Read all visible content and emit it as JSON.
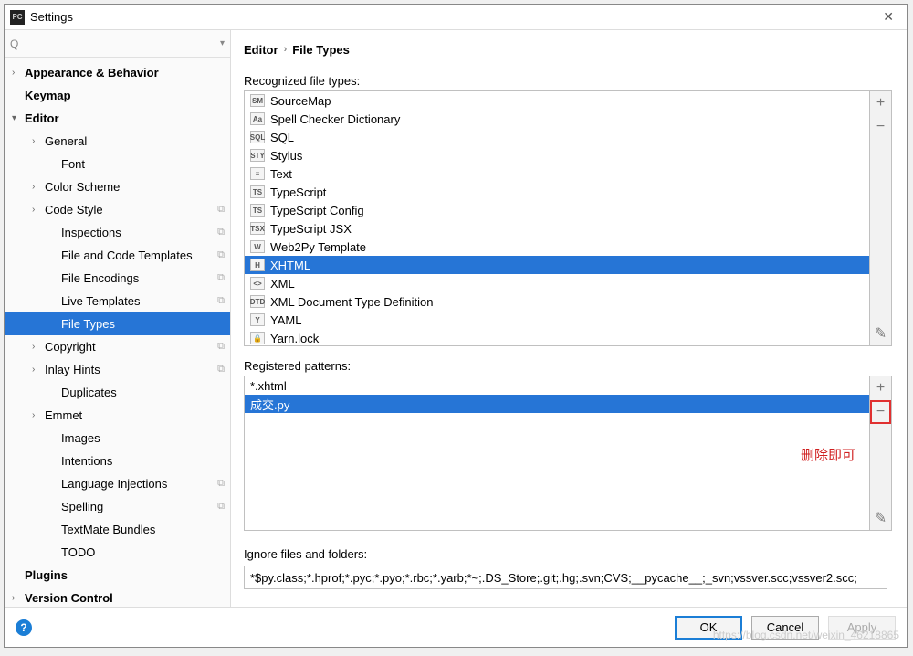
{
  "window": {
    "title": "Settings"
  },
  "search": {
    "placeholder": ""
  },
  "tree": [
    {
      "label": "Appearance & Behavior",
      "lvl": 0,
      "exp": ">",
      "bold": true
    },
    {
      "label": "Keymap",
      "lvl": 0,
      "exp": "",
      "bold": true
    },
    {
      "label": "Editor",
      "lvl": 0,
      "exp": "v",
      "bold": true
    },
    {
      "label": "General",
      "lvl": 1,
      "exp": ">"
    },
    {
      "label": "Font",
      "lvl": 2,
      "exp": ""
    },
    {
      "label": "Color Scheme",
      "lvl": 1,
      "exp": ">"
    },
    {
      "label": "Code Style",
      "lvl": 1,
      "exp": ">",
      "copy": true
    },
    {
      "label": "Inspections",
      "lvl": 2,
      "exp": "",
      "copy": true
    },
    {
      "label": "File and Code Templates",
      "lvl": 2,
      "exp": "",
      "copy": true
    },
    {
      "label": "File Encodings",
      "lvl": 2,
      "exp": "",
      "copy": true
    },
    {
      "label": "Live Templates",
      "lvl": 2,
      "exp": "",
      "copy": true
    },
    {
      "label": "File Types",
      "lvl": 2,
      "exp": "",
      "selected": true
    },
    {
      "label": "Copyright",
      "lvl": 1,
      "exp": ">",
      "copy": true
    },
    {
      "label": "Inlay Hints",
      "lvl": 1,
      "exp": ">",
      "copy": true
    },
    {
      "label": "Duplicates",
      "lvl": 2,
      "exp": ""
    },
    {
      "label": "Emmet",
      "lvl": 1,
      "exp": ">"
    },
    {
      "label": "Images",
      "lvl": 2,
      "exp": ""
    },
    {
      "label": "Intentions",
      "lvl": 2,
      "exp": ""
    },
    {
      "label": "Language Injections",
      "lvl": 2,
      "exp": "",
      "copy": true
    },
    {
      "label": "Spelling",
      "lvl": 2,
      "exp": "",
      "copy": true
    },
    {
      "label": "TextMate Bundles",
      "lvl": 2,
      "exp": ""
    },
    {
      "label": "TODO",
      "lvl": 2,
      "exp": ""
    },
    {
      "label": "Plugins",
      "lvl": 0,
      "exp": "",
      "bold": true
    },
    {
      "label": "Version Control",
      "lvl": 0,
      "exp": ">",
      "bold": true
    }
  ],
  "breadcrumb": {
    "a": "Editor",
    "b": "File Types"
  },
  "labels": {
    "recognized": "Recognized file types:",
    "registered": "Registered patterns:",
    "ignore": "Ignore files and folders:"
  },
  "file_types": [
    {
      "label": "SourceMap",
      "icon": "SM"
    },
    {
      "label": "Spell Checker Dictionary",
      "icon": "Aa"
    },
    {
      "label": "SQL",
      "icon": "SQL"
    },
    {
      "label": "Stylus",
      "icon": "STY"
    },
    {
      "label": "Text",
      "icon": "≡"
    },
    {
      "label": "TypeScript",
      "icon": "TS"
    },
    {
      "label": "TypeScript Config",
      "icon": "TS"
    },
    {
      "label": "TypeScript JSX",
      "icon": "TSX"
    },
    {
      "label": "Web2Py Template",
      "icon": "W"
    },
    {
      "label": "XHTML",
      "icon": "H",
      "selected": true
    },
    {
      "label": "XML",
      "icon": "<>"
    },
    {
      "label": "XML Document Type Definition",
      "icon": "DTD"
    },
    {
      "label": "YAML",
      "icon": "Y"
    },
    {
      "label": "Yarn.lock",
      "icon": "🔒"
    }
  ],
  "patterns": [
    {
      "label": "*.xhtml"
    },
    {
      "label": "成交.py",
      "selected": true
    }
  ],
  "annotation": "删除即可",
  "ignore_value": "*$py.class;*.hprof;*.pyc;*.pyo;*.rbc;*.yarb;*~;.DS_Store;.git;.hg;.svn;CVS;__pycache__;_svn;vssver.scc;vssver2.scc;",
  "buttons": {
    "ok": "OK",
    "cancel": "Cancel",
    "apply": "Apply"
  },
  "side": {
    "plus": "+",
    "minus": "−",
    "edit": "✎"
  },
  "watermark": "https://blog.csdn.net/weixin_46218865"
}
